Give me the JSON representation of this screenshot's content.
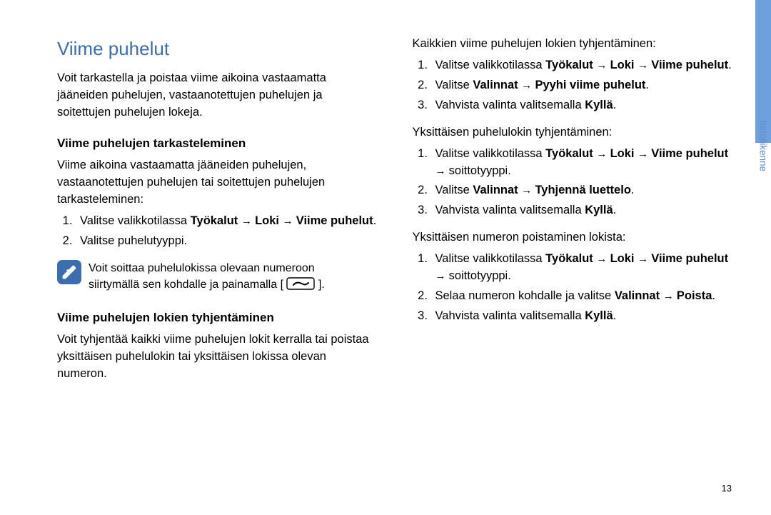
{
  "pageNumber": "13",
  "sideTabLabel": "tietoliikenne",
  "left": {
    "h1": "Viime puhelut",
    "intro": "Voit tarkastella ja poistaa viime aikoina vastaamatta jääneiden puhelujen, vastaanotettujen puhelujen ja soitettujen puhelujen lokeja.",
    "h2a": "Viime puhelujen tarkasteleminen",
    "pA": "Viime aikoina vastaamatta jääneiden puhelujen, vastaanotettujen puhelujen tai soitettujen puhelujen tarkasteleminen:",
    "stepA1_pre": "Valitse valikkotilassa ",
    "tyokalut": "Työkalut",
    "loki": "Loki",
    "viimepuhelut": "Viime puhelut",
    "stepA2": "Valitse puhelutyyppi.",
    "noteLine1": "Voit soittaa puhelulokissa olevaan numeroon",
    "noteLine2a": "siirtymällä sen kohdalle ja painamalla [",
    "noteLine2b": "].",
    "h2b": "Viime puhelujen lokien tyhjentäminen",
    "pB": "Voit tyhjentää kaikki viime puhelujen lokit kerralla tai poistaa yksittäisen puhelulokin tai yksittäisen lokissa olevan numeron."
  },
  "right": {
    "intro": "Kaikkien viime puhelujen lokien tyhjentäminen:",
    "stepA1_pre": "Valitse valikkotilassa ",
    "tyokalut": "Työkalut",
    "loki": "Loki",
    "viimepuhelut": "Viime puhelut",
    "stepA2_pre": "Valitse ",
    "valinnat": "Valinnat",
    "pyyhi": "Pyyhi viime puhelut",
    "stepA3_pre": "Vahvista valinta valitsemalla ",
    "kylla": "Kyllä",
    "pB": "Yksittäisen puhelulokin tyhjentäminen:",
    "stepB1_pre": "Valitse valikkotilassa ",
    "soittotyyppi": "soittotyyppi.",
    "stepB2_pre": "Valitse ",
    "tyhjenna": "Tyhjennä luettelo",
    "stepB3_pre": "Vahvista valinta valitsemalla ",
    "pC": "Yksittäisen numeron poistaminen lokista:",
    "stepC1_pre": "Valitse valikkotilassa ",
    "stepC2_pre": "Selaa numeron kohdalle ja valitse ",
    "poista": "Poista",
    "stepC3_pre": "Vahvista valinta valitsemalla "
  }
}
